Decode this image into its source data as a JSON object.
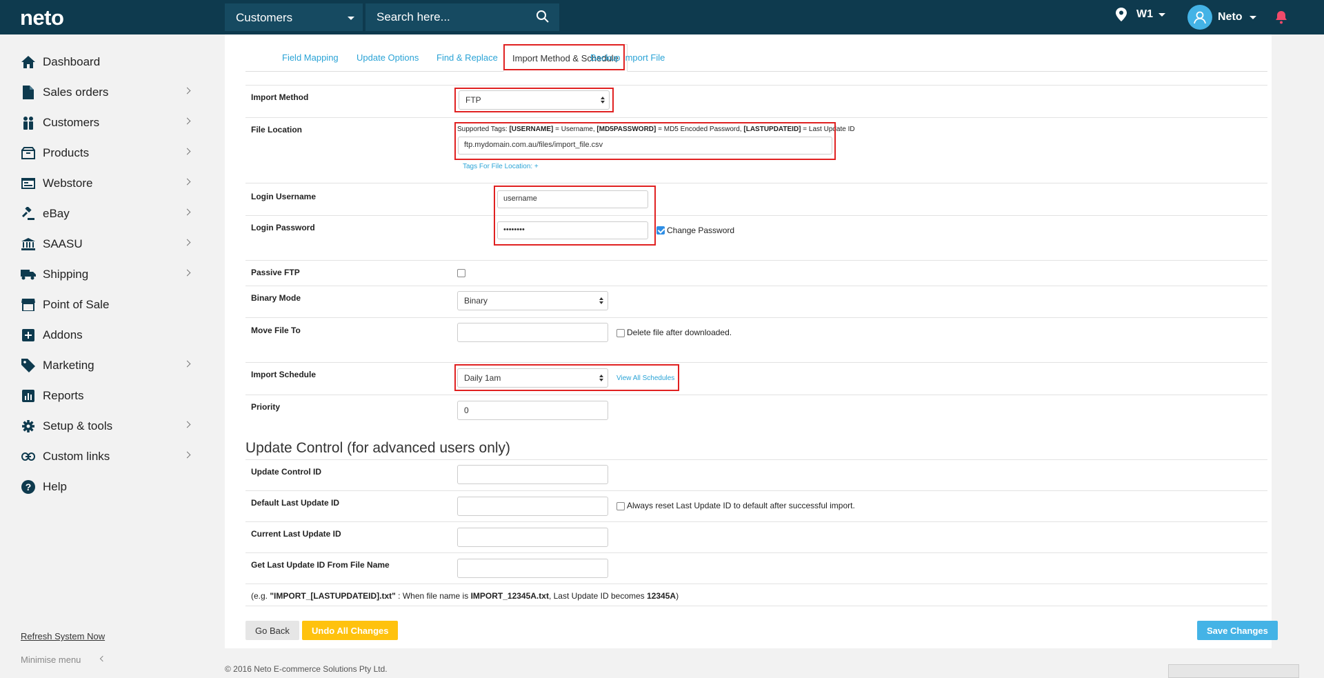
{
  "topbar": {
    "logo": "neto",
    "module": "Customers",
    "search_placeholder": "Search here...",
    "location": "W1",
    "user": "Neto"
  },
  "sidebar": {
    "items": [
      {
        "label": "Dashboard",
        "icon": "home-icon",
        "chevron": false
      },
      {
        "label": "Sales orders",
        "icon": "document-icon",
        "chevron": true
      },
      {
        "label": "Customers",
        "icon": "people-icon",
        "chevron": true
      },
      {
        "label": "Products",
        "icon": "box-icon",
        "chevron": true
      },
      {
        "label": "Webstore",
        "icon": "browser-icon",
        "chevron": true
      },
      {
        "label": "eBay",
        "icon": "gavel-icon",
        "chevron": true
      },
      {
        "label": "SAASU",
        "icon": "bank-icon",
        "chevron": true
      },
      {
        "label": "Shipping",
        "icon": "truck-icon",
        "chevron": true
      },
      {
        "label": "Point of Sale",
        "icon": "store-icon",
        "chevron": false
      },
      {
        "label": "Addons",
        "icon": "plus-square-icon",
        "chevron": false
      },
      {
        "label": "Marketing",
        "icon": "tag-icon",
        "chevron": true
      },
      {
        "label": "Reports",
        "icon": "bar-chart-icon",
        "chevron": false
      },
      {
        "label": "Setup & tools",
        "icon": "gear-icon",
        "chevron": true
      },
      {
        "label": "Custom links",
        "icon": "link-icon",
        "chevron": true
      },
      {
        "label": "Help",
        "icon": "question-icon",
        "chevron": false
      }
    ],
    "refresh": "Refresh System Now",
    "minimise": "Minimise menu"
  },
  "tabs": {
    "field_mapping": "Field Mapping",
    "update_options": "Update Options",
    "find_replace": "Find & Replace",
    "import_method": "Import Method & Schedule",
    "backup": "Backup Import File"
  },
  "form": {
    "import_method": {
      "label": "Import Method",
      "value": "FTP"
    },
    "file_location": {
      "label": "File Location",
      "tags_prefix": "Supported Tags: ",
      "tag1": "[USERNAME]",
      "tag1_desc": " = Username, ",
      "tag2": "[MD5PASSWORD]",
      "tag2_desc": " = MD5 Encoded Password, ",
      "tag3": "[LASTUPDATEID]",
      "tag3_desc": " = Last Update ID",
      "value": "ftp.mydomain.com.au/files/import_file.csv",
      "tags_link": "Tags For File Location: +"
    },
    "login_username": {
      "label": "Login Username",
      "value": "username"
    },
    "login_password": {
      "label": "Login Password",
      "value": "••••••••",
      "change_label": "Change Password"
    },
    "passive_ftp": {
      "label": "Passive FTP"
    },
    "binary_mode": {
      "label": "Binary Mode",
      "value": "Binary"
    },
    "move_file_to": {
      "label": "Move File To",
      "delete_label": "Delete file after downloaded."
    },
    "import_schedule": {
      "label": "Import Schedule",
      "value": "Daily 1am",
      "view_link": "View All Schedules"
    },
    "priority": {
      "label": "Priority",
      "value": "0"
    }
  },
  "update_control": {
    "title": "Update Control (for advanced users only)",
    "control_id": {
      "label": "Update Control ID"
    },
    "default_last": {
      "label": "Default Last Update ID",
      "reset_label": "Always reset Last Update ID to default after successful import."
    },
    "current_last": {
      "label": "Current Last Update ID"
    },
    "from_filename": {
      "label": "Get Last Update ID From File Name"
    },
    "example_prefix": "(e.g. ",
    "example_pattern": "\"IMPORT_[LASTUPDATEID].txt\"",
    "example_mid": " : When file name is ",
    "example_file": "IMPORT_12345A.txt",
    "example_mid2": ", Last Update ID becomes ",
    "example_id": "12345A",
    "example_suffix": ")"
  },
  "buttons": {
    "go_back": "Go Back",
    "undo": "Undo All Changes",
    "save": "Save Changes"
  },
  "footer": {
    "copyright": "© 2016 Neto E-commerce Solutions Pty Ltd."
  },
  "colors": {
    "topbar": "#0e3a4e",
    "accent_blue": "#44b3e6",
    "link_blue": "#2aa3d6",
    "highlight_red": "#e02020",
    "undo_yellow": "#ffc20e"
  }
}
